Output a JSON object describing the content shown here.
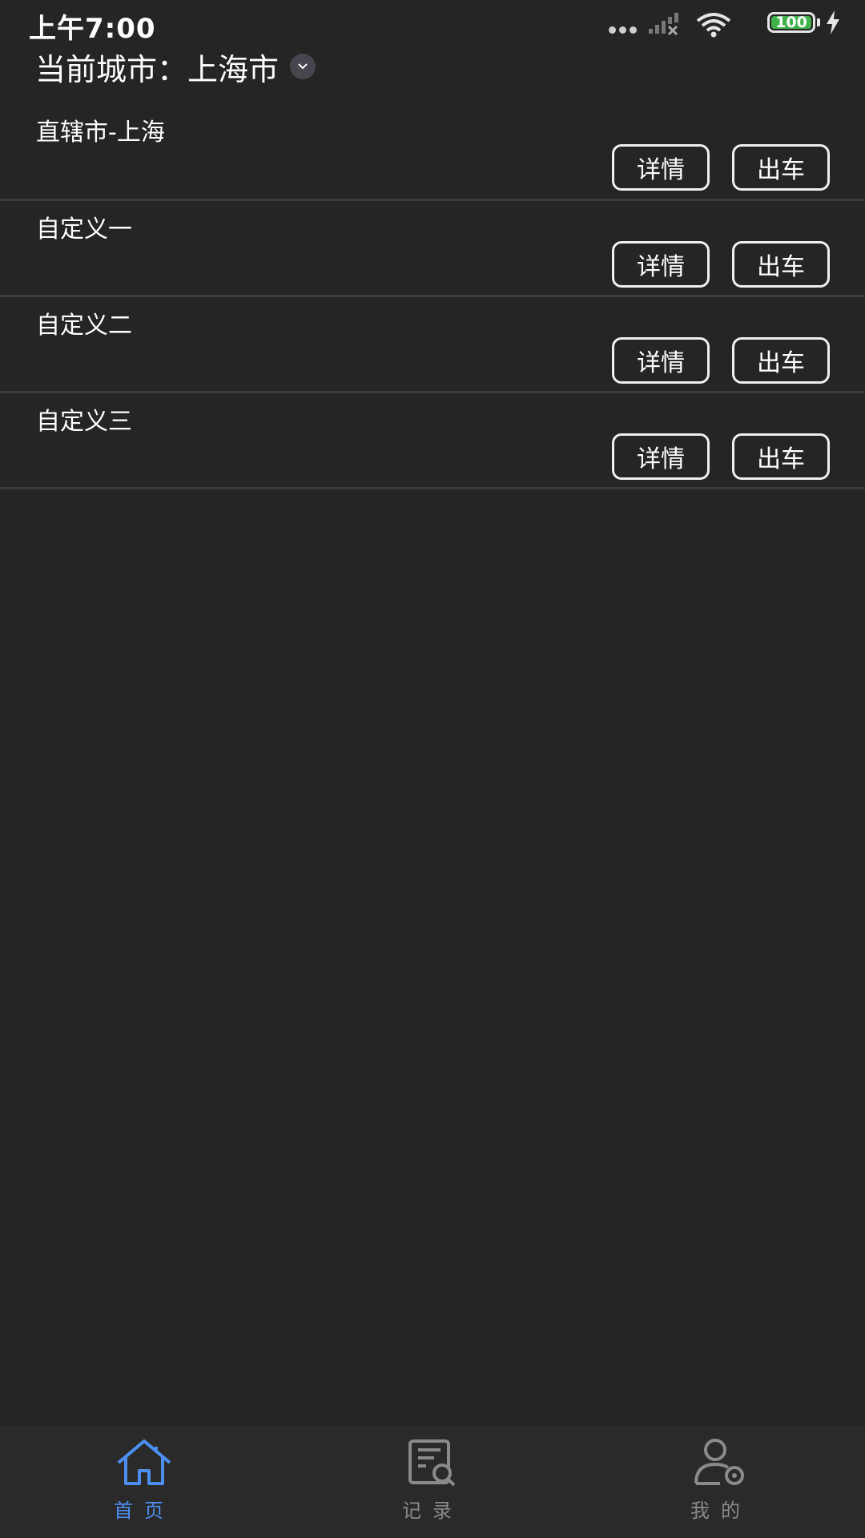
{
  "status_bar": {
    "time": "上午7:00",
    "battery": "100"
  },
  "header": {
    "city_label": "当前城市：",
    "city_value": "上海市"
  },
  "list": {
    "items": [
      {
        "title": "直辖市-上海",
        "detail_label": "详情",
        "depart_label": "出车"
      },
      {
        "title": "自定义一",
        "detail_label": "详情",
        "depart_label": "出车"
      },
      {
        "title": "自定义二",
        "detail_label": "详情",
        "depart_label": "出车"
      },
      {
        "title": "自定义三",
        "detail_label": "详情",
        "depart_label": "出车"
      }
    ]
  },
  "tabs": [
    {
      "label": "首页",
      "icon": "home-icon",
      "active": true
    },
    {
      "label": "记录",
      "icon": "record-search-icon",
      "active": false
    },
    {
      "label": "我的",
      "icon": "user-settings-icon",
      "active": false
    }
  ],
  "colors": {
    "background": "#252525",
    "accent": "#4d8ff0",
    "inactive": "#8a8a8a",
    "battery": "#3fb24a"
  }
}
